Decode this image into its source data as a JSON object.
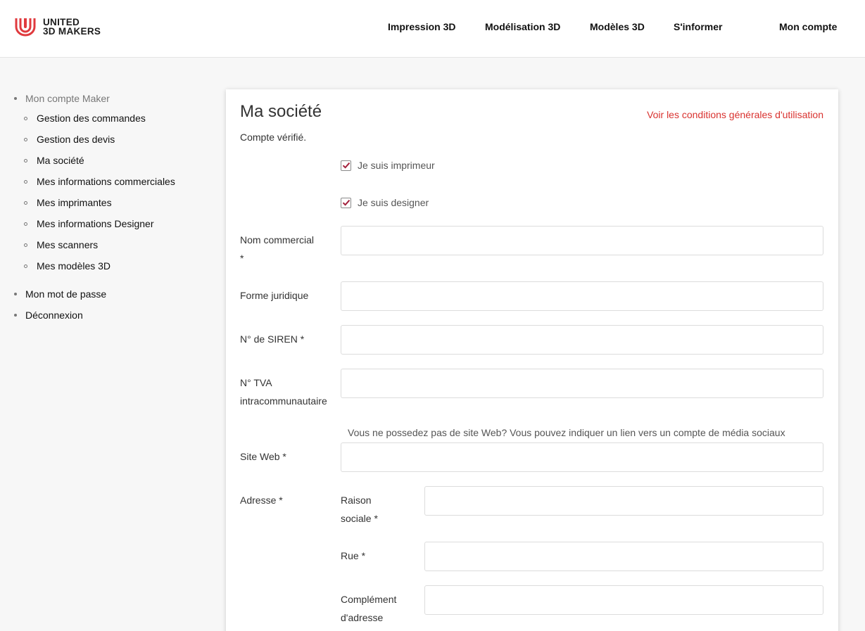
{
  "header": {
    "logo": {
      "line1": "UNITED",
      "line2": "3D MAKERS",
      "icon": "united-3d-makers-logo-icon",
      "color": "#e03a3e"
    },
    "nav": [
      {
        "label": "Impression 3D"
      },
      {
        "label": "Modélisation 3D"
      },
      {
        "label": "Modèles 3D"
      },
      {
        "label": "S'informer"
      },
      {
        "label": "Mon compte"
      }
    ]
  },
  "sidebar": {
    "section_title": "Mon compte Maker",
    "sub_items": [
      {
        "label": "Gestion des commandes"
      },
      {
        "label": "Gestion des devis"
      },
      {
        "label": "Ma société"
      },
      {
        "label": "Mes informations commerciales"
      },
      {
        "label": "Mes imprimantes"
      },
      {
        "label": "Mes informations Designer"
      },
      {
        "label": "Mes scanners"
      },
      {
        "label": "Mes modèles 3D"
      }
    ],
    "other_items": [
      {
        "label": "Mon mot de passe"
      },
      {
        "label": "Déconnexion"
      }
    ]
  },
  "main": {
    "title": "Ma société",
    "cgu_link": "Voir les conditions générales d'utilisation",
    "status": "Compte vérifié.",
    "checkboxes": [
      {
        "label": "Je suis imprimeur",
        "checked": true
      },
      {
        "label": "Je suis designer",
        "checked": true
      }
    ],
    "fields": {
      "nom_commercial": {
        "label_1": "Nom commercial",
        "label_2": "*",
        "value": ""
      },
      "forme_juridique": {
        "label": "Forme juridique",
        "value": ""
      },
      "siren": {
        "label": "N° de SIREN *",
        "value": ""
      },
      "tva": {
        "label_1": "N° TVA",
        "label_2": "intracommunautaire",
        "value": ""
      },
      "site_web_hint": "Vous ne possedez pas de site Web? Vous pouvez indiquer un lien vers un compte de média sociaux",
      "site_web": {
        "label": "Site Web *",
        "value": ""
      },
      "adresse": {
        "label": "Adresse *"
      },
      "raison_sociale": {
        "label_1": "Raison",
        "label_2": "sociale *",
        "value": ""
      },
      "rue": {
        "label": "Rue *",
        "value": ""
      },
      "complement": {
        "label_1": "Complément",
        "label_2": "d'adresse",
        "value": ""
      }
    },
    "colors": {
      "accent": "#d9322f",
      "checkbox": "#a3213c"
    }
  }
}
